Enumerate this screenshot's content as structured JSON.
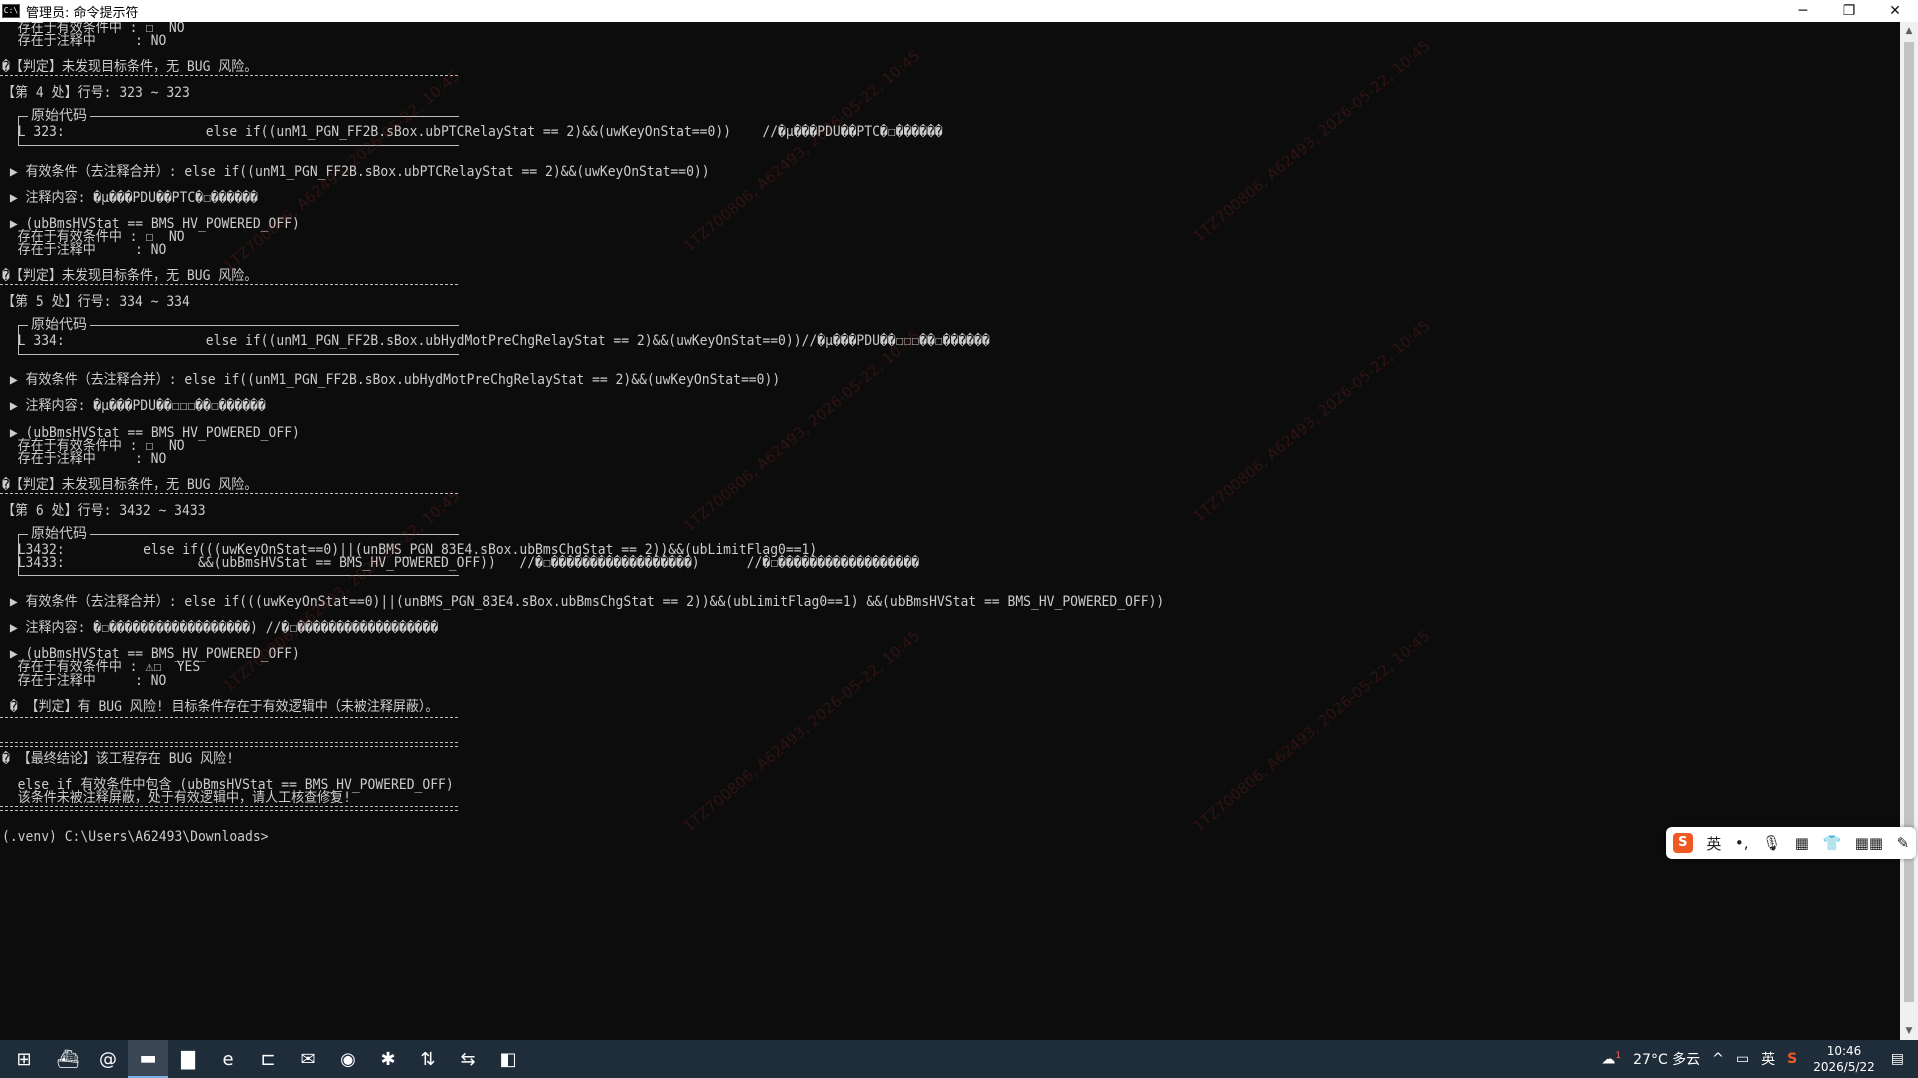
{
  "window": {
    "title": "管理员: 命令提示符",
    "icon_text": "C:\\",
    "controls": [
      "─",
      "❐",
      "✕"
    ]
  },
  "console": {
    "lines": [
      {
        "text": "  存在于有效条件中 : ☐  NO",
        "row": 0
      },
      {
        "text": "  存在于注释中     : NO",
        "row": 1
      },
      {
        "text": "�【判定】未发现目标条件，无 BUG 风险。",
        "row": 3
      },
      {
        "text": "【第 4 处】行号: 323 ~ 323",
        "row": 5
      },
      {
        "text": "  L 323:                  else if((unM1_PGN_FF2B.sBox.ubPTCRelayStat == 2)&&(uwKeyOnStat==0))    //�µ���PDU��PTC�☐������",
        "row": 8
      },
      {
        "text": " ▶ 有效条件（去注释合并）: else if((unM1_PGN_FF2B.sBox.ubPTCRelayStat == 2)&&(uwKeyOnStat==0))",
        "row": 11
      },
      {
        "text": " ▶ 注释内容: �µ���PDU��PTC�☐������",
        "row": 13
      },
      {
        "text": " ▶ (ubBmsHVStat == BMS_HV_POWERED_OFF)",
        "row": 15
      },
      {
        "text": "  存在于有效条件中 : ☐  NO",
        "row": 16
      },
      {
        "text": "  存在于注释中     : NO",
        "row": 17
      },
      {
        "text": "�【判定】未发现目标条件，无 BUG 风险。",
        "row": 19
      },
      {
        "text": "【第 5 处】行号: 334 ~ 334",
        "row": 21
      },
      {
        "text": "  L 334:                  else if((unM1_PGN_FF2B.sBox.ubHydMotPreChgRelayStat == 2)&&(uwKeyOnStat==0))//�µ���PDU��☐☐☐��☐������",
        "row": 24
      },
      {
        "text": " ▶ 有效条件（去注释合并）: else if((unM1_PGN_FF2B.sBox.ubHydMotPreChgRelayStat == 2)&&(uwKeyOnStat==0))",
        "row": 27
      },
      {
        "text": " ▶ 注释内容: �µ���PDU��☐☐☐��☐������",
        "row": 29
      },
      {
        "text": " ▶ (ubBmsHVStat == BMS_HV_POWERED_OFF)",
        "row": 31
      },
      {
        "text": "  存在于有效条件中 : ☐  NO",
        "row": 32
      },
      {
        "text": "  存在于注释中     : NO",
        "row": 33
      },
      {
        "text": "�【判定】未发现目标条件，无 BUG 风险。",
        "row": 35
      },
      {
        "text": "【第 6 处】行号: 3432 ~ 3433",
        "row": 37
      },
      {
        "text": "  L3432:          else if(((uwKeyOnStat==0)||(unBMS_PGN_83E4.sBox.ubBmsChgStat == 2))&&(ubLimitFlag0==1)",
        "row": 40
      },
      {
        "text": "  L3433:                 &&(ubBmsHVStat == BMS_HV_POWERED_OFF))   //�☐������������������)      //�☐������������������",
        "row": 41
      },
      {
        "text": " ▶ 有效条件（去注释合并）: else if(((uwKeyOnStat==0)||(unBMS_PGN_83E4.sBox.ubBmsChgStat == 2))&&(ubLimitFlag0==1) &&(ubBmsHVStat == BMS_HV_POWERED_OFF))",
        "row": 44
      },
      {
        "text": " ▶ 注释内容: �☐������������������) //�☐������������������",
        "row": 46
      },
      {
        "text": " ▶ (ubBmsHVStat == BMS_HV_POWERED_OFF)",
        "row": 48
      },
      {
        "text": "  存在于有效条件中 : ⚠☐  YES",
        "row": 49
      },
      {
        "text": "  存在于注释中     : NO",
        "row": 50
      },
      {
        "text": " � 【判定】有 BUG 风险! 目标条件存在于有效逻辑中（未被注释屏蔽）。",
        "row": 52
      },
      {
        "text": "� 【最终结论】该工程存在 BUG 风险!",
        "row": 56
      },
      {
        "text": "  else if 有效条件中包含 (ubBmsHVStat == BMS_HV_POWERED_OFF)",
        "row": 58
      },
      {
        "text": "  该条件未被注释屏蔽，处于有效逻辑中，请人工核查修复!",
        "row": 59
      },
      {
        "text": "(.venv) C:\\Users\\A62493\\Downloads>",
        "row": 62
      }
    ],
    "box_label": "原始代码",
    "watermark": "1TZ700806, A62493, 2026-05-22, 10:45"
  },
  "ime": {
    "logo": "S",
    "items": [
      "英",
      "•,",
      "🎙",
      "▦",
      "👕",
      "▦▦",
      "✎"
    ]
  },
  "taskbar": {
    "start_icon": "⊞",
    "apps": [
      {
        "name": "ship-app-icon",
        "glyph": "⛴"
      },
      {
        "name": "spiral-app-icon",
        "glyph": "@"
      },
      {
        "name": "terminal-app-icon",
        "glyph": "▬"
      },
      {
        "name": "folder-app-icon",
        "glyph": "▇"
      },
      {
        "name": "edge-app-icon",
        "glyph": "e"
      },
      {
        "name": "code-app-icon",
        "glyph": "⊏"
      },
      {
        "name": "mail-app-icon",
        "glyph": "✉"
      },
      {
        "name": "chat-app-icon",
        "glyph": "◉"
      },
      {
        "name": "network-app-icon",
        "glyph": "✱"
      },
      {
        "name": "transfer-app-icon",
        "glyph": "⇅"
      },
      {
        "name": "compare-app-icon",
        "glyph": "⇆"
      },
      {
        "name": "notes-app-icon",
        "glyph": "◧"
      }
    ],
    "weather": "27°C 多云",
    "weather_badge": "1",
    "tray_glyphs": [
      "^",
      "▭",
      "英",
      "S"
    ],
    "time": "10:46",
    "date": "2026/5/22",
    "notification_icon": "▤"
  },
  "colors": {
    "console_bg": "#0c0c0c",
    "console_fg": "#cccccc",
    "taskbar_bg": "#1f2c3a"
  }
}
